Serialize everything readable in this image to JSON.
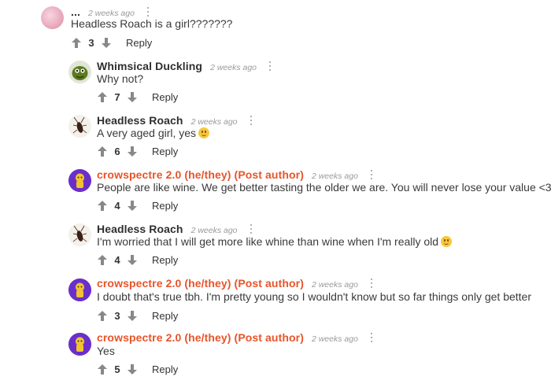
{
  "comments": [
    {
      "author": "...",
      "time": "2 weeks ago",
      "text": "Headless Roach is a girl???????",
      "votes": "3",
      "reply": "Reply",
      "avatar": "pink-blob",
      "op": false
    },
    {
      "author": "Whimsical Duckling",
      "time": "2 weeks ago",
      "text": "Why not?",
      "votes": "7",
      "reply": "Reply",
      "avatar": "green-creature",
      "op": false
    },
    {
      "author": "Headless Roach",
      "time": "2 weeks ago",
      "text": "A very aged girl, yes",
      "votes": "6",
      "reply": "Reply",
      "avatar": "cockroach",
      "op": false,
      "emoji": "upside-down-face"
    },
    {
      "author": "crowspectre 2.0 (he/they) (Post author)",
      "time": "2 weeks ago",
      "text": "People are like wine. We get better tasting the older we are. You will never lose your value <3",
      "votes": "4",
      "reply": "Reply",
      "avatar": "yellow-figure-purple",
      "op": true
    },
    {
      "author": "Headless Roach",
      "time": "2 weeks ago",
      "text": "I'm worried that I will get more like whine than wine when I'm really old",
      "votes": "4",
      "reply": "Reply",
      "avatar": "cockroach",
      "op": false,
      "emoji": "upside-down-face"
    },
    {
      "author": "crowspectre 2.0 (he/they) (Post author)",
      "time": "2 weeks ago",
      "text": "I doubt that's true tbh. I'm pretty young so I wouldn't know but so far things only get better",
      "votes": "3",
      "reply": "Reply",
      "avatar": "yellow-figure-purple",
      "op": true
    },
    {
      "author": "crowspectre 2.0 (he/they) (Post author)",
      "time": "2 weeks ago",
      "text": "Yes",
      "votes": "5",
      "reply": "Reply",
      "avatar": "yellow-figure-purple",
      "op": true
    }
  ],
  "colors": {
    "op_author": "#e8542a",
    "crow_avatar_bg": "#6b2fc9"
  },
  "icons": {
    "upvote": "arrow-up-icon",
    "downvote": "arrow-down-icon",
    "options": "kebab-menu-icon"
  }
}
